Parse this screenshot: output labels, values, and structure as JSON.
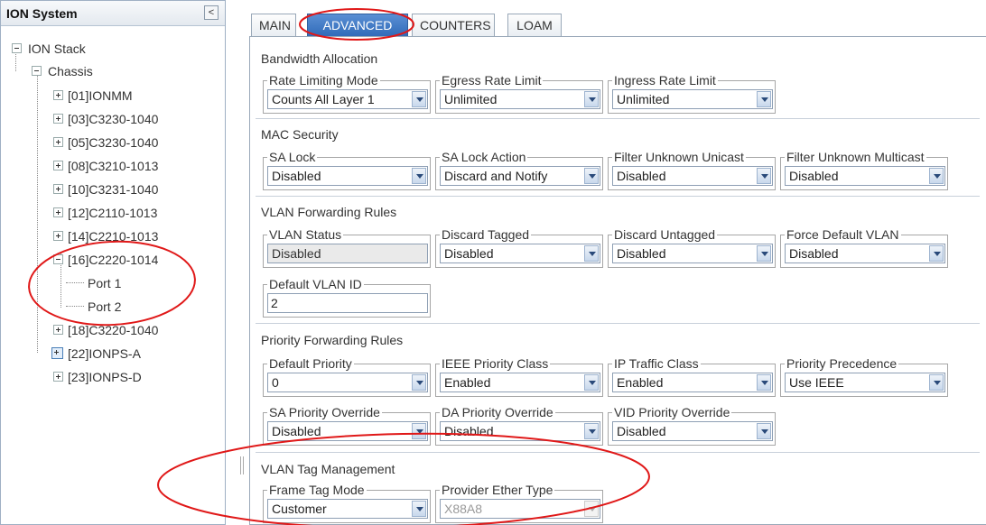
{
  "tree": {
    "header": "ION System",
    "collapse_glyph": "<",
    "nodes": {
      "root": "ION Stack",
      "chassis": "Chassis",
      "n01": "[01]IONMM",
      "n03": "[03]C3230-1040",
      "n05": "[05]C3230-1040",
      "n08": "[08]C3210-1013",
      "n10": "[10]C3231-1040",
      "n12": "[12]C2110-1013",
      "n14": "[14]C2210-1013",
      "n16": "[16]C2220-1014",
      "port1": "Port 1",
      "port2": "Port 2",
      "n18": "[18]C3220-1040",
      "n22": "[22]IONPS-A",
      "n23": "[23]IONPS-D"
    }
  },
  "tabs": {
    "main": "MAIN",
    "advanced": "ADVANCED",
    "counters": "COUNTERS",
    "loam": "LOAM",
    "active": "ADVANCED"
  },
  "bandwidth": {
    "title": "Bandwidth Allocation",
    "rate_limiting_mode": {
      "label": "Rate Limiting Mode",
      "value": "Counts All Layer 1"
    },
    "egress_rate_limit": {
      "label": "Egress Rate Limit",
      "value": "Unlimited"
    },
    "ingress_rate_limit": {
      "label": "Ingress Rate Limit",
      "value": "Unlimited"
    }
  },
  "mac_security": {
    "title": "MAC Security",
    "sa_lock": {
      "label": "SA Lock",
      "value": "Disabled"
    },
    "sa_lock_action": {
      "label": "SA Lock Action",
      "value": "Discard and Notify"
    },
    "filter_unknown_unicast": {
      "label": "Filter Unknown Unicast",
      "value": "Disabled"
    },
    "filter_unknown_multicast": {
      "label": "Filter Unknown Multicast",
      "value": "Disabled"
    }
  },
  "vlan_forwarding": {
    "title": "VLAN Forwarding Rules",
    "vlan_status": {
      "label": "VLAN Status",
      "value": "Disabled"
    },
    "discard_tagged": {
      "label": "Discard Tagged",
      "value": "Disabled"
    },
    "discard_untagged": {
      "label": "Discard Untagged",
      "value": "Disabled"
    },
    "force_default_vlan": {
      "label": "Force Default VLAN",
      "value": "Disabled"
    },
    "default_vlan_id": {
      "label": "Default VLAN ID",
      "value": "2"
    }
  },
  "priority_forwarding": {
    "title": "Priority Forwarding Rules",
    "default_priority": {
      "label": "Default Priority",
      "value": "0"
    },
    "ieee_priority_class": {
      "label": "IEEE Priority Class",
      "value": "Enabled"
    },
    "ip_traffic_class": {
      "label": "IP Traffic Class",
      "value": "Enabled"
    },
    "priority_precedence": {
      "label": "Priority Precedence",
      "value": "Use IEEE"
    },
    "sa_priority_override": {
      "label": "SA Priority Override",
      "value": "Disabled"
    },
    "da_priority_override": {
      "label": "DA Priority Override",
      "value": "Disabled"
    },
    "vid_priority_override": {
      "label": "VID Priority Override",
      "value": "Disabled"
    }
  },
  "vlan_tag_mgmt": {
    "title": "VLAN Tag Management",
    "frame_tag_mode": {
      "label": "Frame Tag Mode",
      "value": "Customer"
    },
    "provider_ether_type": {
      "label": "Provider Ether Type",
      "value": "X88A8"
    }
  },
  "colors": {
    "annotation_red": "#e01818",
    "tab_active_blue": "#2f6ab8"
  }
}
